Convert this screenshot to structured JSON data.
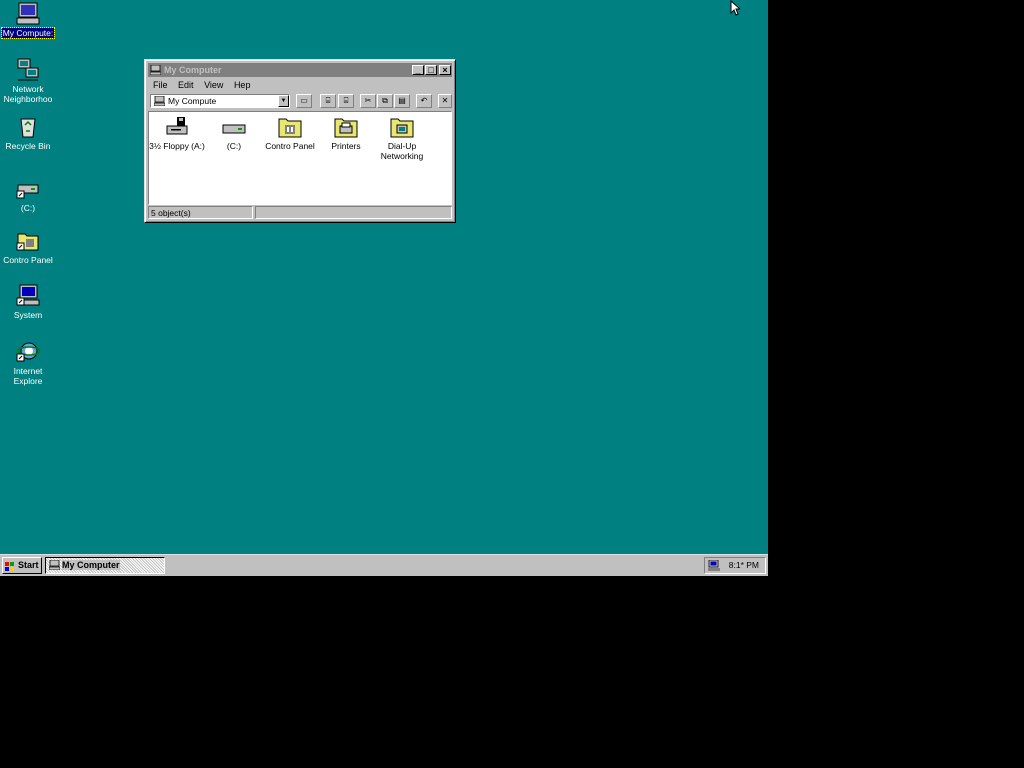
{
  "desktop": {
    "background_color": "#008080",
    "icons": [
      {
        "label": "My Compute:",
        "icon": "my-computer-icon",
        "selected": true
      },
      {
        "label": "Network\nNeighborhoo",
        "icon": "network-neighborhood-icon"
      },
      {
        "label": "Recycle Bin",
        "icon": "recycle-bin-icon"
      },
      {
        "label": "(C:)",
        "icon": "drive-shortcut-icon"
      },
      {
        "label": "Contro Panel",
        "icon": "control-panel-shortcut-icon"
      },
      {
        "label": "System",
        "icon": "system-shortcut-icon"
      },
      {
        "label": "Internet\nExplore",
        "icon": "internet-explorer-icon"
      }
    ]
  },
  "window": {
    "title": "My Computer",
    "menu": [
      "File",
      "Edit",
      "View",
      "Hep"
    ],
    "address": "My Compute",
    "items": [
      {
        "label": "3½ Floppy (A:)",
        "icon": "floppy-drive-icon"
      },
      {
        "label": "(C:)",
        "icon": "hard-drive-icon"
      },
      {
        "label": "Contro Panel",
        "icon": "control-panel-folder-icon"
      },
      {
        "label": "Printers",
        "icon": "printers-folder-icon"
      },
      {
        "label": "Dial-Up\nNetworking",
        "icon": "dialup-networking-folder-icon"
      }
    ],
    "status": "5 object(s)"
  },
  "taskbar": {
    "start_label": "Start",
    "task_label": "My Computer",
    "clock": "8:1* PM"
  }
}
